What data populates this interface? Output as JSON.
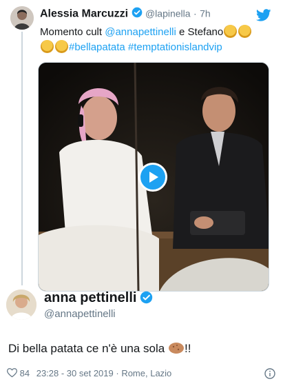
{
  "parent_tweet": {
    "author_name": "Alessia Marcuzzi",
    "handle": "@lapinella",
    "separator": "·",
    "time_ago": "7h",
    "text_prefix": "Momento cult ",
    "mention_1": "@annapettinelli",
    "text_middle": " e Stefano",
    "hashtag_1": "#bellapatata",
    "hashtag_2": "#temptationislandvip",
    "emoji_name": "princess-emoji"
  },
  "reply_tweet": {
    "author_name": "anna pettinelli",
    "handle": "@annapettinelli",
    "text": "Di bella patata ce n'è una sola",
    "text_suffix": "!!",
    "emoji_name": "potato-emoji",
    "like_count": "84",
    "timestamp": "23:28 - 30 set 2019",
    "location_separator": " · ",
    "location": "Rome, Lazio"
  },
  "colors": {
    "accent": "#1da1f2",
    "muted": "#657786",
    "text": "#14171a"
  },
  "icons": [
    "twitter-bird-icon",
    "verified-badge-icon",
    "play-icon",
    "heart-icon",
    "info-icon"
  ]
}
